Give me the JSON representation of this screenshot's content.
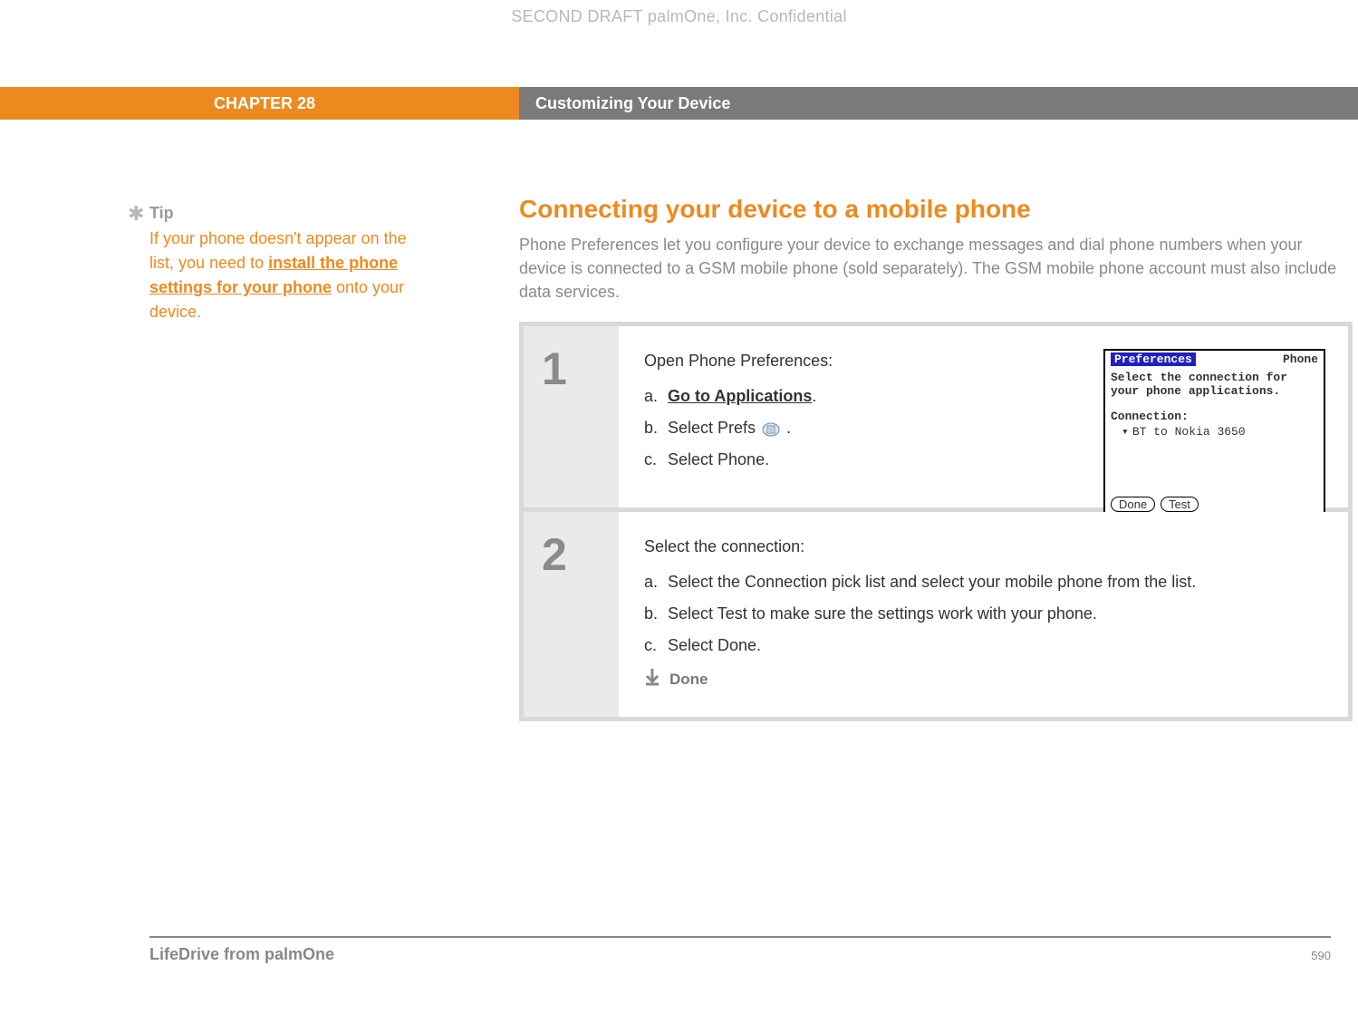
{
  "watermark": "SECOND DRAFT palmOne, Inc.  Confidential",
  "header": {
    "chapter": "CHAPTER 28",
    "title": "Customizing Your Device"
  },
  "tip": {
    "label": "Tip",
    "body_pre": "If your phone doesn't appear on the list, you need to ",
    "link": "install the phone settings for your phone",
    "body_post": " onto your device."
  },
  "main": {
    "title": "Connecting your device to a mobile phone",
    "intro": "Phone Preferences let you configure your device to exchange messages and dial phone numbers when your device is connected to a GSM mobile phone (sold separately). The GSM mobile phone account must also include data services."
  },
  "step1": {
    "num": "1",
    "heading": "Open Phone Preferences:",
    "a_lbl": "a.",
    "a_link": "Go to Applications",
    "a_post": ".",
    "b_lbl": "b.",
    "b_pre": "Select Prefs ",
    "b_post": ".",
    "c_lbl": "c.",
    "c_text": "Select Phone."
  },
  "palm": {
    "title_l": "Preferences",
    "title_r": "Phone",
    "sel": "Select the connection for your phone applications.",
    "conn_lbl": "Connection:",
    "conn_val": "BT to Nokia 3650",
    "done": "Done",
    "test": "Test"
  },
  "step2": {
    "num": "2",
    "heading": "Select the connection:",
    "a_lbl": "a.",
    "a_text": "Select the Connection pick list and select your mobile phone from the list.",
    "b_lbl": "b.",
    "b_text": "Select Test to make sure the settings work with your phone.",
    "c_lbl": "c.",
    "c_text": "Select Done.",
    "done": "Done"
  },
  "footer": {
    "left": "LifeDrive from palmOne",
    "page": "590"
  }
}
